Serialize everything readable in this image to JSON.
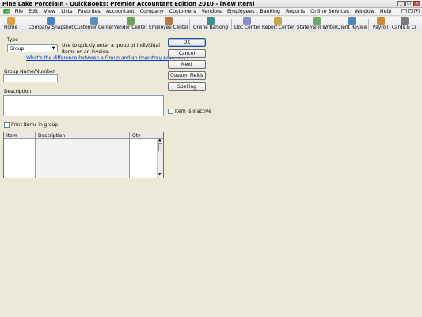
{
  "window": {
    "title": "Pine Lake Porcelain  - QuickBooks: Premier Accountant Edition 2010 - [New Item]",
    "controls": [
      "_",
      "□",
      "x"
    ]
  },
  "menubar": {
    "items": [
      "File",
      "Edit",
      "View",
      "Lists",
      "Favorites",
      "Accountant",
      "Company",
      "Customers",
      "Vendors",
      "Employees",
      "Banking",
      "Reports",
      "Online Services",
      "Window",
      "Help"
    ],
    "right_controls": [
      "_",
      "□",
      "x"
    ]
  },
  "toolbar": {
    "items": [
      {
        "label": "Home",
        "icon": "home-icon"
      },
      {
        "label": "Company Snapshot",
        "icon": "company-snapshot-icon"
      },
      {
        "label": "Customer Center",
        "icon": "customer-center-icon"
      },
      {
        "label": "Vendor Center",
        "icon": "vendor-center-icon"
      },
      {
        "label": "Employee Center",
        "icon": "employee-center-icon"
      },
      {
        "label": "Online Banking",
        "icon": "online-banking-icon"
      },
      {
        "label": "Doc Center",
        "icon": "doc-center-icon"
      },
      {
        "label": "Report Center",
        "icon": "report-center-icon"
      },
      {
        "label": "Statement Writer",
        "icon": "statement-writer-icon"
      },
      {
        "label": "Client Review",
        "icon": "client-review-icon"
      },
      {
        "label": "Payroll",
        "icon": "payroll-icon"
      },
      {
        "label": "Cards & Cr",
        "icon": "cards-icon"
      }
    ]
  },
  "form": {
    "type_label": "Type",
    "type_value": "Group",
    "type_hint": "Use to quickly enter a group of individual items on an invoice.",
    "type_link": "What's the difference between a Group and an Inventory Assembly?",
    "group_name_label": "Group Name/Number",
    "group_name_value": "",
    "description_label": "Description",
    "description_value": "",
    "inactive_label": "Item is inactive",
    "print_items_label": "Print items in group",
    "buttons": {
      "ok": "OK",
      "cancel": "Cancel",
      "next": "Next",
      "custom_fields": "Custom Fields",
      "spelling": "Spelling"
    },
    "grid_columns": [
      "Item",
      "Description",
      "Qty"
    ]
  }
}
